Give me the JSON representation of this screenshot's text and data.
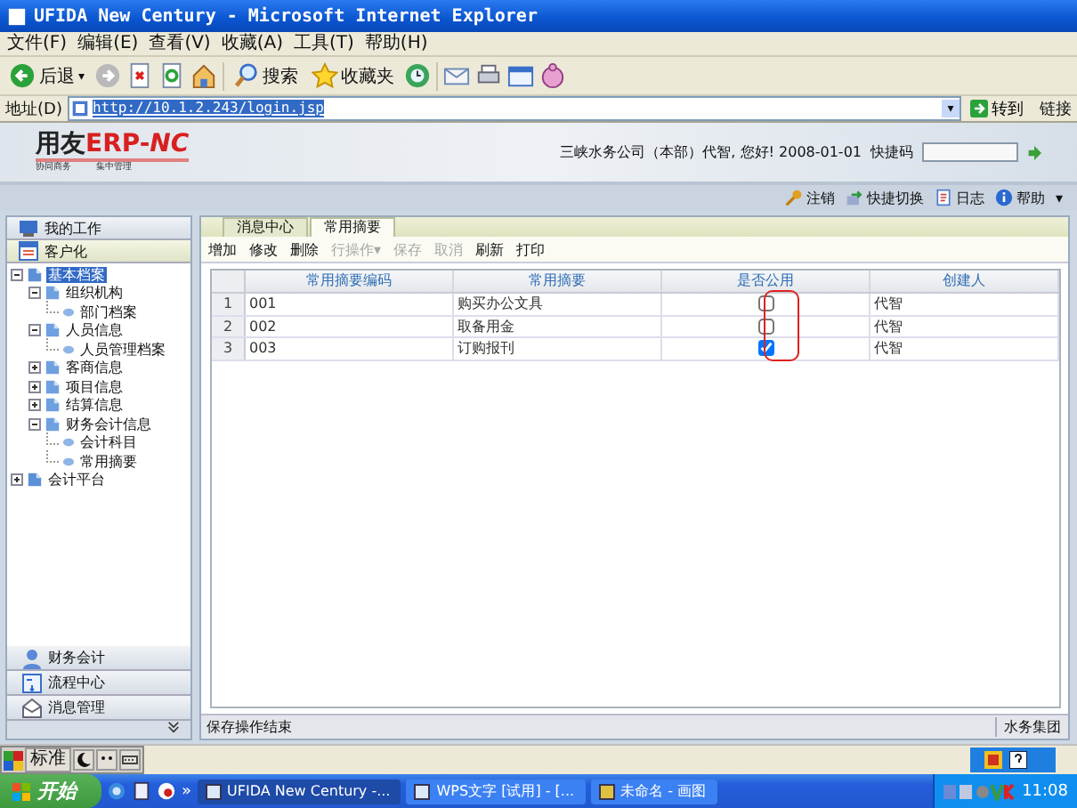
{
  "window": {
    "title": "UFIDA New Century - Microsoft Internet Explorer"
  },
  "menu": [
    "文件(F)",
    "编辑(E)",
    "查看(V)",
    "收藏(A)",
    "工具(T)",
    "帮助(H)"
  ],
  "ie_toolbar": {
    "back": "后退",
    "back_caret": "▾",
    "search": "搜索",
    "favorites": "收藏夹"
  },
  "address": {
    "label": "地址(D)",
    "url": "http://10.1.2.243/login.jsp",
    "dropdown": "▾",
    "go": "转到",
    "links": "链接"
  },
  "header": {
    "logo_cn": "用友",
    "logo_erp": "ERP-",
    "logo_nc": "NC",
    "logo_sub_1": "协同商务",
    "logo_sub_2": "集中管理",
    "user_info": "三峡水务公司（本部）代智, 您好! 2008-01-01",
    "quick_code_label": "快捷码"
  },
  "actions": [
    "注销",
    "快捷切换",
    "日志",
    "帮助"
  ],
  "actions_caret": "▾",
  "sidebar": {
    "top_items": [
      {
        "label": "我的工作",
        "selected": false
      },
      {
        "label": "客户化",
        "selected": true
      }
    ],
    "tree": [
      {
        "label": "基本档案",
        "kind": "root",
        "expanded": true,
        "selected": true,
        "children": [
          {
            "label": "组织机构",
            "kind": "folder",
            "expanded": true,
            "selected": false,
            "children": [
              {
                "label": "部门档案",
                "kind": "leaf",
                "selected": false
              }
            ]
          },
          {
            "label": "人员信息",
            "kind": "folder",
            "expanded": true,
            "selected": false,
            "children": [
              {
                "label": "人员管理档案",
                "kind": "leaf",
                "selected": false
              }
            ]
          },
          {
            "label": "客商信息",
            "kind": "folder",
            "expanded": false,
            "selected": false
          },
          {
            "label": "项目信息",
            "kind": "folder",
            "expanded": false,
            "selected": false
          },
          {
            "label": "结算信息",
            "kind": "folder",
            "expanded": false,
            "selected": false
          },
          {
            "label": "财务会计信息",
            "kind": "folder",
            "expanded": true,
            "selected": false,
            "children": [
              {
                "label": "会计科目",
                "kind": "leaf",
                "selected": false
              },
              {
                "label": "常用摘要",
                "kind": "leaf",
                "selected": false
              }
            ]
          }
        ]
      },
      {
        "label": "会计平台",
        "kind": "root",
        "expanded": false,
        "selected": false
      }
    ],
    "bottom_items": [
      "财务会计",
      "流程中心",
      "消息管理"
    ]
  },
  "tabs": [
    {
      "label": "消息中心",
      "selected": false
    },
    {
      "label": "常用摘要",
      "selected": true
    }
  ],
  "toolbar": [
    {
      "label": "增加",
      "disabled": false
    },
    {
      "label": "修改",
      "disabled": false
    },
    {
      "label": "删除",
      "disabled": false
    },
    {
      "label": "行操作",
      "disabled": true,
      "caret": "▾"
    },
    {
      "label": "保存",
      "disabled": true
    },
    {
      "label": "取消",
      "disabled": true
    },
    {
      "label": "刷新",
      "disabled": false
    },
    {
      "label": "打印",
      "disabled": false
    }
  ],
  "table": {
    "columns": [
      "常用摘要编码",
      "常用摘要",
      "是否公用",
      "创建人"
    ],
    "rows": [
      {
        "index": "1",
        "code": "001",
        "summary": "购买办公文具",
        "public": false,
        "creator": "代智"
      },
      {
        "index": "2",
        "code": "002",
        "summary": "取备用金",
        "public": false,
        "creator": "代智"
      },
      {
        "index": "3",
        "code": "003",
        "summary": "订购报刊",
        "public": true,
        "creator": "代智"
      }
    ]
  },
  "status_bar": {
    "message": "保存操作结束",
    "group": "水务集团"
  },
  "ime": {
    "mode": "标准"
  },
  "taskbar": {
    "start": "开始",
    "more": "»",
    "tasks": [
      {
        "label": "UFIDA New Century -...",
        "selected": true
      },
      {
        "label": "WPS文字 [试用] - [...",
        "selected": false
      },
      {
        "label": "未命名 - 画图",
        "selected": false
      }
    ],
    "clock": "11:08"
  }
}
